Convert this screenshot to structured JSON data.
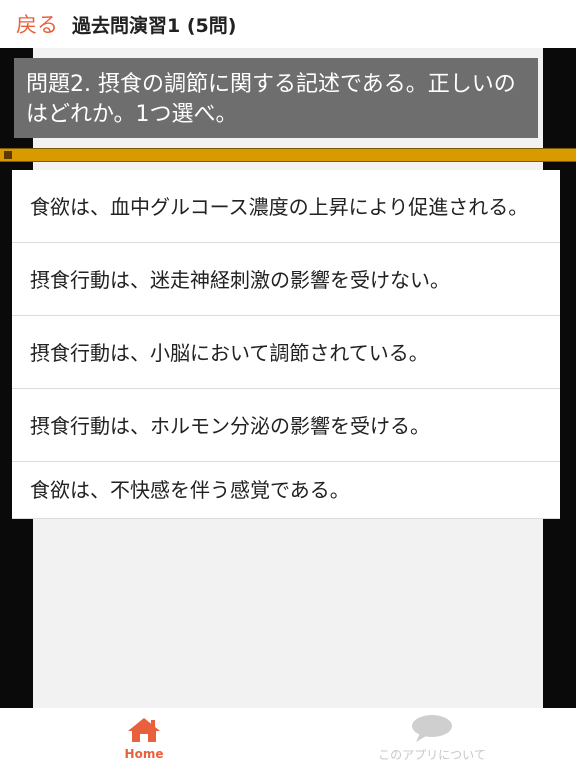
{
  "header": {
    "back_label": "戻る",
    "title": "過去問演習1 (5問)"
  },
  "question": {
    "text": "問題2. 摂食の調節に関する記述である。正しいのはどれか。1つ選べ。"
  },
  "choices": [
    "食欲は、血中グルコース濃度の上昇により促進される。",
    "摂食行動は、迷走神経刺激の影響を受けない。",
    "摂食行動は、小脳において調節されている。",
    "摂食行動は、ホルモン分泌の影響を受ける。",
    "食欲は、不快感を伴う感覚である。"
  ],
  "bottom_nav": {
    "home_label": "Home",
    "home_icon": "home-icon",
    "about_label": "このアプリについて",
    "about_icon": "speech-bubble-icon"
  },
  "colors": {
    "accent": "#e8613c",
    "question_bg": "#6e6e6e",
    "progress": "#d89a00"
  }
}
